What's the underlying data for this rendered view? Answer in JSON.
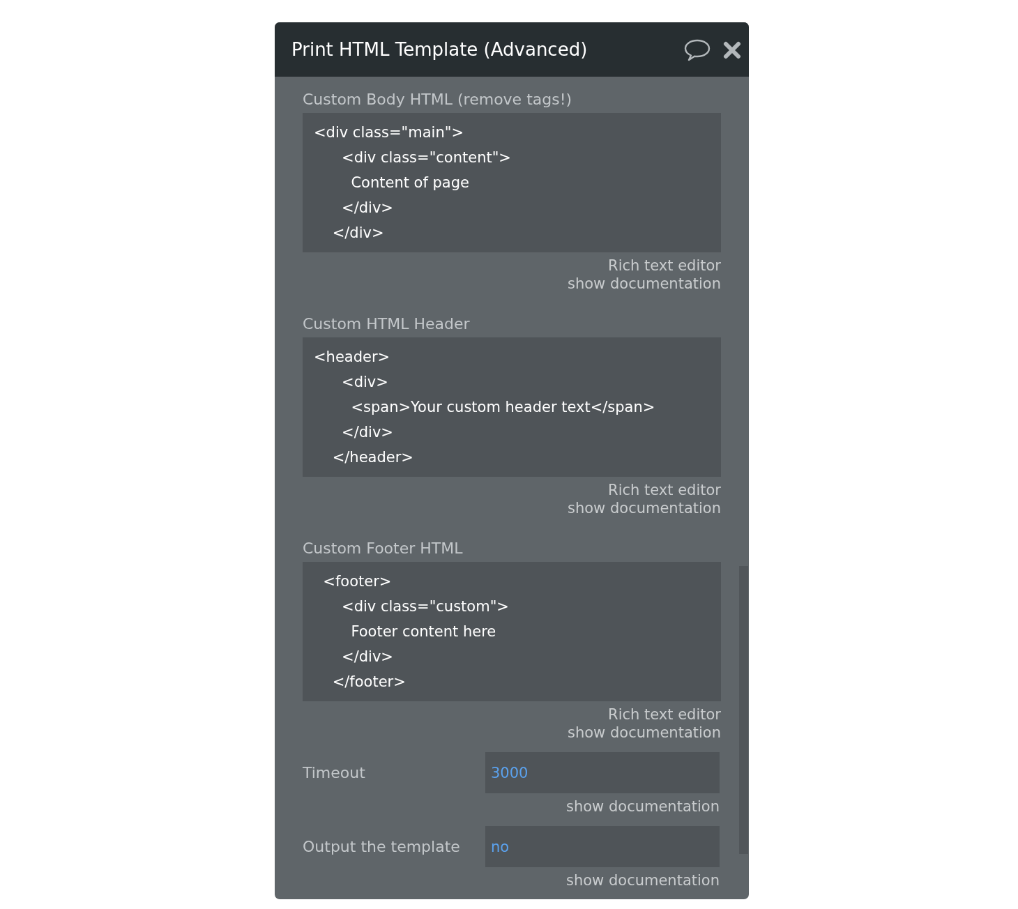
{
  "dialog": {
    "title": "Print HTML Template (Advanced)"
  },
  "sections": [
    {
      "kind": "code",
      "label": "Custom Body HTML (remove tags!)",
      "value": "<div class=\"main\">\n      <div class=\"content\">\n        Content of page\n      </div>\n    </div>",
      "links": [
        "Rich text editor",
        "show documentation"
      ]
    },
    {
      "kind": "code",
      "label": "Custom HTML Header",
      "value": "<header>\n      <div>\n        <span>Your custom header text</span>\n      </div>\n    </header>",
      "links": [
        "Rich text editor",
        "show documentation"
      ]
    },
    {
      "kind": "code",
      "label": "Custom Footer HTML",
      "value": "  <footer>\n      <div class=\"custom\">\n        Footer content here\n      </div>\n    </footer>",
      "links": [
        "Rich text editor",
        "show documentation"
      ]
    },
    {
      "kind": "input",
      "label": "Timeout",
      "value": "3000",
      "links": [
        "show documentation"
      ]
    },
    {
      "kind": "input",
      "label": "Output the template",
      "value": "no",
      "links": [
        "show documentation"
      ]
    }
  ]
}
